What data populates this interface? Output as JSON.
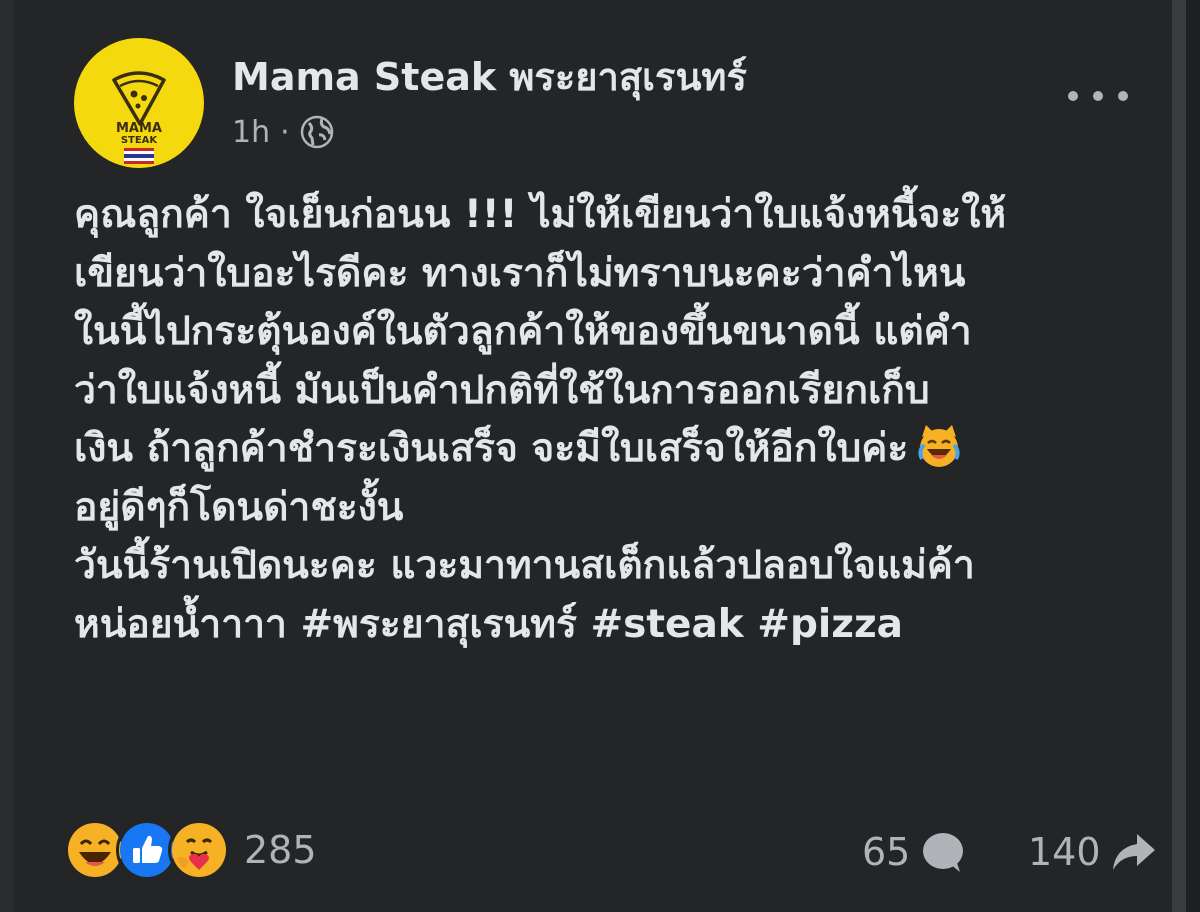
{
  "post": {
    "page_name": "Mama Steak พระยาสุเรนทร์",
    "time": "1h",
    "separator": "·",
    "privacy_icon": "globe-icon",
    "more_icon": "more-options-icon",
    "avatar": {
      "logo_text_1": "MAMA",
      "logo_text_2": "STEAK",
      "bg_color": "#f5d90f"
    },
    "lines": [
      "คุณลูกค้า ใจเย็นก่อนน !!! ไม่ให้เขียนว่าใบแจ้งหนี้จะให้",
      "เขียนว่าใบอะไรดีคะ ทางเราก็ไม่ทราบนะคะว่าคำไหน",
      "ในนี้ไปกระตุ้นองค์ในตัวลูกค้าให้ของขึ้นขนาดนี้ แต่คำ",
      "ว่าใบแจ้งหนี้ มันเป็นคำปกติที่ใช้ในการออกเรียกเก็บ",
      "เงิน ถ้าลูกค้าชำระเงินเสร็จ จะมีใบเสร็จให้อีกใบค่ะ",
      "อยู่ดีๆก็โดนด่าชะงั้น",
      "วันนี้ร้านเปิดนะคะ แวะมาทานสเต็กแล้วปลอบใจแม่ค้า",
      "หน่อยน้ำาาา #พระยาสุเรนทร์ #steak #pizza"
    ],
    "inline_emoji": "crying-laughing-cat-emoji"
  },
  "footer": {
    "reaction_icons": [
      "haha-reaction-icon",
      "like-reaction-icon",
      "care-reaction-icon"
    ],
    "reaction_count": "285",
    "comment_count": "65",
    "comment_icon": "comment-icon",
    "share_count": "140",
    "share_icon": "share-icon"
  },
  "colors": {
    "background": "#242526",
    "text_primary": "#e4e6eb",
    "text_secondary": "#b0b3b8",
    "like_blue": "#1877f2",
    "haha_yellow": "#f7b125"
  }
}
